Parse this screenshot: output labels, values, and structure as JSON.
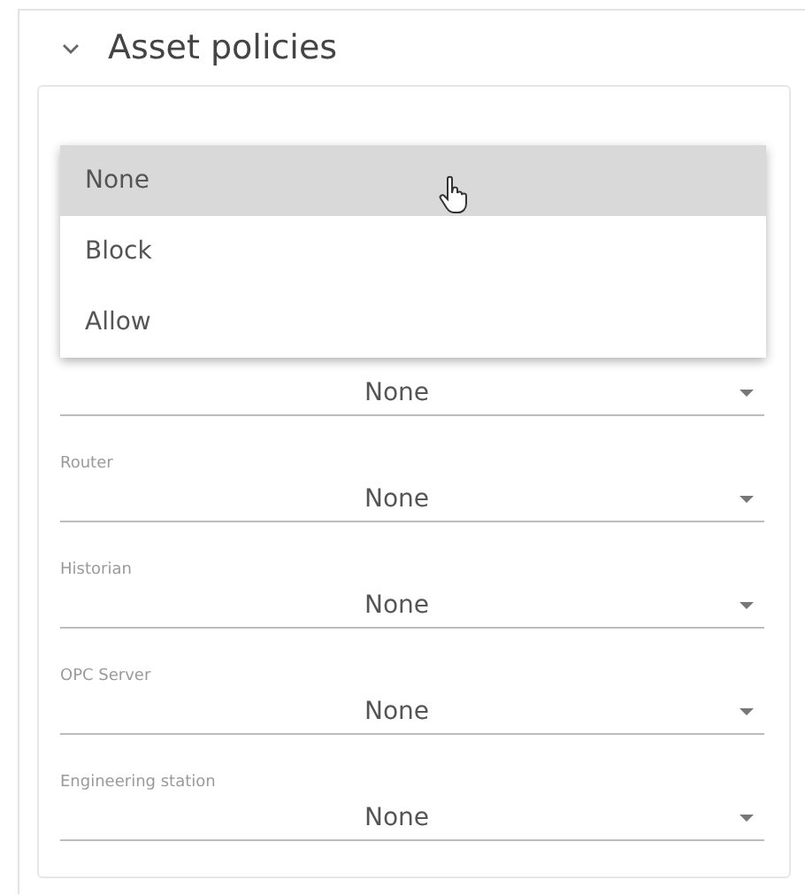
{
  "section": {
    "title": "Asset policies",
    "expanded": true
  },
  "fields": [
    {
      "value": "None"
    },
    {
      "label": "Router",
      "value": "None"
    },
    {
      "label": "Historian",
      "value": "None"
    },
    {
      "label": "OPC Server",
      "value": "None"
    },
    {
      "label": "Engineering station",
      "value": "None"
    }
  ],
  "menu": [
    {
      "label": "None",
      "selected": true
    },
    {
      "label": "Block",
      "selected": false
    },
    {
      "label": "Allow",
      "selected": false
    }
  ]
}
